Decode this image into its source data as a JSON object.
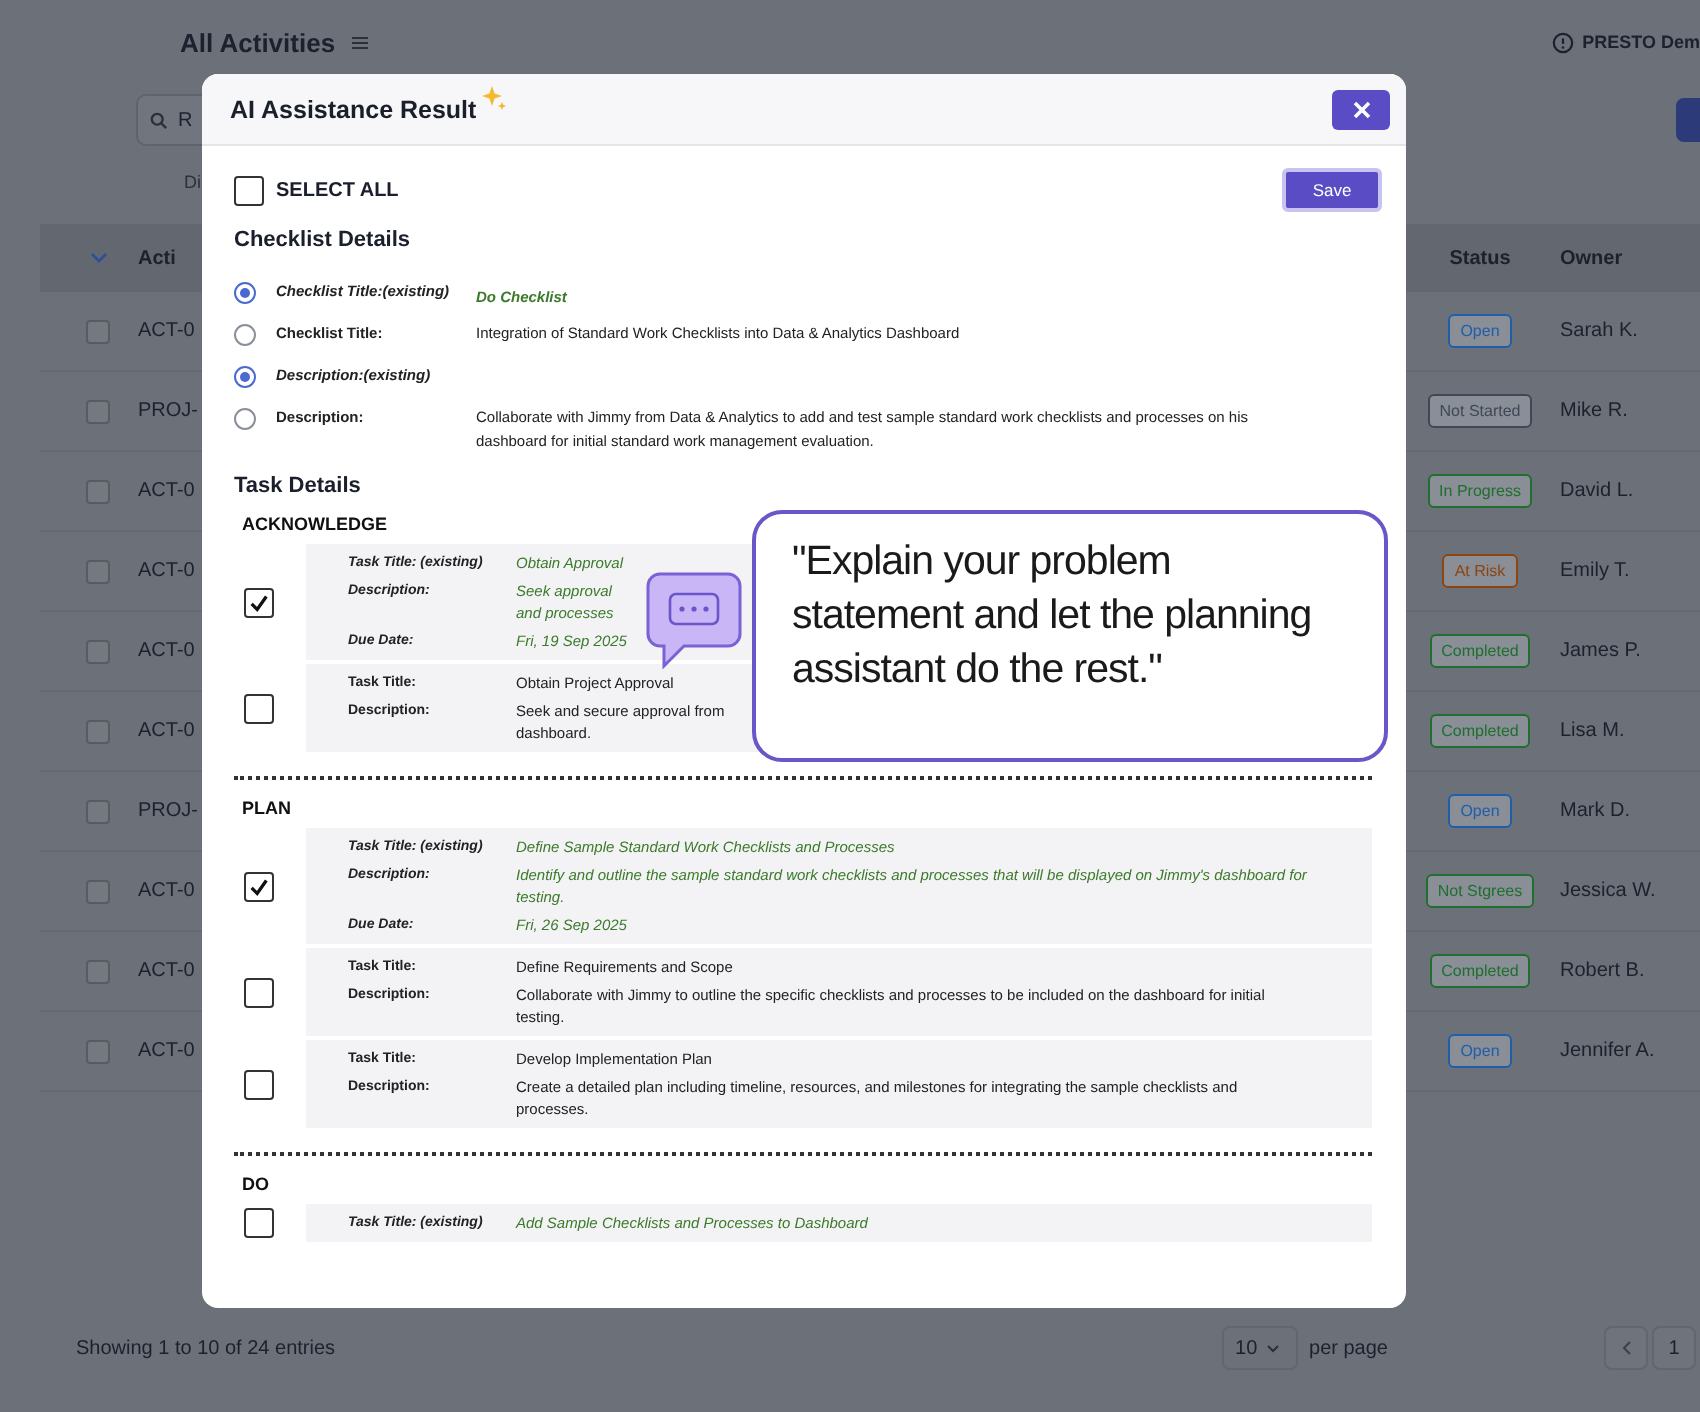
{
  "background": {
    "title": "All Activities",
    "account": "PRESTO Dem",
    "search": {
      "placeholder": "R"
    },
    "filter_label": "Di",
    "table": {
      "columns": [
        "Acti",
        "Status",
        "Owner"
      ],
      "rows": [
        {
          "checked": false,
          "id": "ACT-0",
          "status": "Open",
          "color": "#1f5fa8",
          "owner": "Sarah K."
        },
        {
          "checked": false,
          "id": "PROJ-",
          "status": "Not Started",
          "color": "#3f4856",
          "owner": "Mike R."
        },
        {
          "checked": false,
          "id": "ACT-0",
          "status": "In Progress",
          "color": "#1f6f2f",
          "owner": "David L."
        },
        {
          "checked": false,
          "id": "ACT-0",
          "status": "At Risk",
          "color": "#8a4510",
          "owner": "Emily T."
        },
        {
          "checked": false,
          "id": "ACT-0",
          "status": "Completed",
          "color": "#1f6f2f",
          "owner": "James P."
        },
        {
          "checked": false,
          "id": "ACT-0",
          "status": "Completed",
          "color": "#1f6f2f",
          "owner": "Lisa M."
        },
        {
          "checked": false,
          "id": "PROJ-",
          "status": "Open",
          "color": "#1f5fa8",
          "owner": "Mark D."
        },
        {
          "checked": false,
          "id": "ACT-0",
          "status": "Not Stgrees",
          "color": "#1f6f2f",
          "owner": "Jessica W."
        },
        {
          "checked": false,
          "id": "ACT-0",
          "status": "Completed",
          "color": "#1f6f2f",
          "owner": "Robert B."
        },
        {
          "checked": false,
          "id": "ACT-0",
          "status": "Open",
          "color": "#1f5fa8",
          "owner": "Jennifer A."
        }
      ]
    },
    "footer": {
      "summary": "Showing 1 to 10 of 24 entries",
      "page_size": "10",
      "per_page": "per page",
      "page": "1"
    }
  },
  "modal": {
    "title": "AI Assistance Result",
    "select_all": {
      "label": "SELECT ALL",
      "checked": false
    },
    "save": "Save",
    "checklist": {
      "heading": "Checklist Details",
      "options": [
        {
          "label": "Checklist Title:(existing)",
          "existing": true,
          "selected": true,
          "value": "Do Checklist"
        },
        {
          "label": "Checklist Title:",
          "existing": false,
          "selected": false,
          "value": "Integration of Standard Work Checklists into Data & Analytics Dashboard"
        },
        {
          "label": "Description:(existing)",
          "existing": true,
          "selected": true
        },
        {
          "label": "Description:",
          "existing": false,
          "selected": false,
          "value": "Collaborate with Jimmy from Data & Analytics to add and test sample standard work checklists and processes on his dashboard for initial standard work management evaluation."
        }
      ]
    },
    "tasks": {
      "heading": "Task Details",
      "phases": [
        {
          "name": "ACKNOWLEDGE",
          "tasks": [
            {
              "checked": true,
              "existing": true,
              "fields": [
                {
                  "label": "Task Title: (existing)",
                  "value": "Obtain Approval"
                },
                {
                  "label": "Description:",
                  "value": "Seek approval",
                  "value_2": "and processes"
                },
                {
                  "label": "Due Date:",
                  "value": "Fri, 19 Sep 2025"
                }
              ]
            },
            {
              "checked": false,
              "existing": false,
              "fields": [
                {
                  "label": "Task Title:",
                  "value": "Obtain Project Approval"
                },
                {
                  "label": "Description:",
                  "value": "Seek and secure approval from",
                  "value_2": "dashboard."
                }
              ]
            }
          ]
        },
        {
          "name": "PLAN",
          "tasks": [
            {
              "checked": true,
              "existing": true,
              "fields": [
                {
                  "label": "Task Title: (existing)",
                  "value": "Define Sample Standard Work Checklists and Processes"
                },
                {
                  "label": "Description:",
                  "value": "Identify and outline the sample standard work checklists and processes that will be displayed on Jimmy's dashboard for testing."
                },
                {
                  "label": "Due Date:",
                  "value": "Fri, 26 Sep 2025"
                }
              ]
            },
            {
              "checked": false,
              "existing": false,
              "fields": [
                {
                  "label": "Task Title:",
                  "value": "Define Requirements and Scope"
                },
                {
                  "label": "Description:",
                  "value": "Collaborate with Jimmy to outline the specific checklists and processes to be included on the dashboard for initial testing."
                }
              ]
            },
            {
              "checked": false,
              "existing": false,
              "fields": [
                {
                  "label": "Task Title:",
                  "value": "Develop Implementation Plan"
                },
                {
                  "label": "Description:",
                  "value": "Create a detailed plan including timeline, resources, and milestones for integrating the sample checklists and processes."
                }
              ]
            }
          ]
        },
        {
          "name": "DO",
          "tasks": [
            {
              "checked": false,
              "existing": true,
              "fields": [
                {
                  "label": "Task Title: (existing)",
                  "value": "Add Sample Checklists and Processes to Dashboard"
                }
              ]
            }
          ]
        }
      ]
    }
  },
  "callout": {
    "text": "\"Explain your problem\nstatement and let the planning\nassistant do the rest.\""
  }
}
